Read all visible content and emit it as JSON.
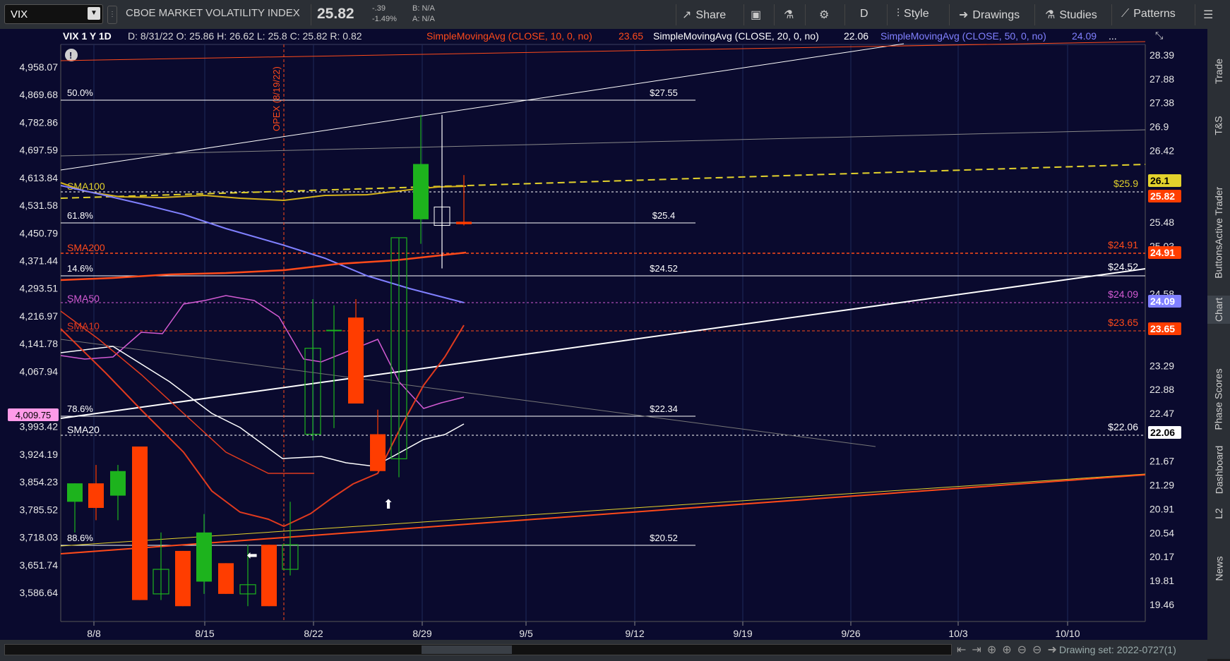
{
  "toolbar": {
    "symbol": "VIX",
    "description": "CBOE MARKET VOLATILITY INDEX",
    "last": "25.82",
    "change": "-.39",
    "change_pct": "-1.49%",
    "bid": "B: N/A",
    "ask": "A: N/A",
    "share": "Share",
    "period": "D",
    "style": "Style",
    "drawings": "Drawings",
    "studies": "Studies",
    "patterns": "Patterns"
  },
  "header": {
    "title": "VIX 1 Y 1D",
    "ohlc": "D: 8/31/22  O: 25.86  H: 26.62  L: 25.8  C: 25.82  R: 0.82",
    "sma10": "SimpleMovingAvg (CLOSE, 10, 0, no)",
    "sma10_val": "23.65",
    "sma20": "SimpleMovingAvg (CLOSE, 20, 0, no)",
    "sma20_val": "22.06",
    "sma50": "SimpleMovingAvg (CLOSE, 50, 0, no)",
    "sma50_val": "24.09",
    "more": "..."
  },
  "right_tabs": [
    "Trade",
    "T&S",
    "Active Trader",
    "Buttons",
    "Chart",
    "Phase Scores",
    "Dashboard",
    "L2",
    "News"
  ],
  "bottom": {
    "drawing_set": "Drawing set: 2022-0727(1)"
  },
  "colors": {
    "up": "#1db31d",
    "down": "#ff3d00",
    "background": "#0a0a2e",
    "sma10": "#e03a1e",
    "sma20": "#ffffff",
    "sma50": "#8080ff",
    "sma100": "#d4b21b",
    "sma200": "#ff4a1a",
    "volume_line": "#d35bd3"
  },
  "chart_data": {
    "type": "candlestick",
    "x_tick_labels": [
      "8/8",
      "8/15",
      "8/22",
      "8/29",
      "9/5",
      "9/12",
      "9/19",
      "9/26",
      "10/3",
      "10/10"
    ],
    "right_axis_labels": [
      "28.39",
      "27.88",
      "27.38",
      "26.9",
      "26.42",
      "26.1",
      "25.82",
      "25.48",
      "25.03",
      "24.91",
      "24.58",
      "24.09",
      "23.65",
      "23.29",
      "22.88",
      "22.47",
      "22.06",
      "21.67",
      "21.29",
      "20.91",
      "20.54",
      "20.17",
      "19.81",
      "19.46"
    ],
    "left_axis_labels": [
      "4,958.07",
      "4,869.68",
      "4,782.86",
      "4,697.59",
      "4,613.84",
      "4,531.58",
      "4,450.79",
      "4,371.44",
      "4,293.51",
      "4,216.97",
      "4,141.78",
      "4,067.94",
      "4,009.75",
      "3,993.42",
      "3,924.19",
      "3,854.23",
      "3,785.52",
      "3,718.03",
      "3,651.74",
      "3,586.64"
    ],
    "candles": [
      {
        "date": "8/5",
        "o": 21.3,
        "h": 21.6,
        "l": 20.8,
        "c": 21.6
      },
      {
        "date": "8/8",
        "o": 21.6,
        "h": 21.9,
        "l": 21.0,
        "c": 21.2
      },
      {
        "date": "8/9",
        "o": 21.4,
        "h": 21.9,
        "l": 21.0,
        "c": 21.8
      },
      {
        "date": "8/10",
        "o": 22.2,
        "h": 22.2,
        "l": 19.7,
        "c": 19.7
      },
      {
        "date": "8/11",
        "o": 19.8,
        "h": 20.8,
        "l": 19.7,
        "c": 20.2
      },
      {
        "date": "8/12",
        "o": 20.5,
        "h": 20.5,
        "l": 19.6,
        "c": 19.6
      },
      {
        "date": "8/15",
        "o": 20.0,
        "h": 21.1,
        "l": 19.8,
        "c": 20.8
      },
      {
        "date": "8/16",
        "o": 20.3,
        "h": 20.3,
        "l": 19.8,
        "c": 19.8
      },
      {
        "date": "8/17",
        "o": 19.8,
        "h": 20.6,
        "l": 19.6,
        "c": 19.95
      },
      {
        "date": "8/18",
        "o": 20.6,
        "h": 20.6,
        "l": 19.6,
        "c": 19.6
      },
      {
        "date": "8/19",
        "o": 20.2,
        "h": 21.3,
        "l": 20.1,
        "c": 20.6
      },
      {
        "date": "8/22",
        "o": 22.4,
        "h": 24.6,
        "l": 22.3,
        "c": 23.8
      },
      {
        "date": "8/23",
        "o": 24.1,
        "h": 24.5,
        "l": 22.5,
        "c": 24.1
      },
      {
        "date": "8/24",
        "o": 24.3,
        "h": 24.6,
        "l": 22.9,
        "c": 22.9
      },
      {
        "date": "8/25",
        "o": 22.4,
        "h": 22.8,
        "l": 21.8,
        "c": 21.8
      },
      {
        "date": "8/26",
        "o": 22.0,
        "h": 25.6,
        "l": 21.7,
        "c": 25.6
      },
      {
        "date": "8/29",
        "o": 25.9,
        "h": 27.6,
        "l": 25.5,
        "c": 26.8
      },
      {
        "date": "8/30",
        "o": 25.8,
        "h": 27.6,
        "l": 25.1,
        "c": 26.1
      },
      {
        "date": "8/31",
        "o": 25.86,
        "h": 26.62,
        "l": 25.8,
        "c": 25.82
      }
    ],
    "sma_labels": [
      "SMA100",
      "SMA200",
      "SMA50",
      "SMA10",
      "SMA20"
    ],
    "sma_values": {
      "SMA10": 23.65,
      "SMA20": 22.06,
      "SMA50": 24.09,
      "SMA100": 25.9,
      "SMA200": 24.91
    },
    "fib_levels": [
      {
        "pct": "50.0%",
        "value": "$27.55"
      },
      {
        "pct": "61.8%",
        "value": "$25.4"
      },
      {
        "pct": "14.6%",
        "value": "$24.52"
      },
      {
        "pct": "78.6%",
        "value": "$22.34"
      },
      {
        "pct": "88.6%",
        "value": "$20.52"
      }
    ],
    "price_level_labels": [
      {
        "label": "$25.9",
        "color": "#e3d22c"
      },
      {
        "label": "$24.91",
        "color": "#ff4a1a"
      },
      {
        "label": "$24.52",
        "color": "#ffffff"
      },
      {
        "label": "$24.09",
        "color": "#d35bd3"
      },
      {
        "label": "$23.65",
        "color": "#ff4a1a"
      },
      {
        "label": "$22.06",
        "color": "#ffffff"
      }
    ],
    "price_tags": [
      {
        "label": "26.1",
        "bg": "#e3d22c",
        "fg": "#000"
      },
      {
        "label": "25.82",
        "bg": "#ff3d00",
        "fg": "#fff"
      },
      {
        "label": "24.91",
        "bg": "#ff3d00",
        "fg": "#fff"
      },
      {
        "label": "24.09",
        "bg": "#8080ff",
        "fg": "#fff"
      },
      {
        "label": "23.65",
        "bg": "#ff3d00",
        "fg": "#fff"
      },
      {
        "label": "22.06",
        "bg": "#ffffff",
        "fg": "#000"
      }
    ],
    "left_tag": "4,009.75",
    "annotation": "OPEX (8/19/22)",
    "ylim": [
      19.46,
      28.6
    ]
  }
}
